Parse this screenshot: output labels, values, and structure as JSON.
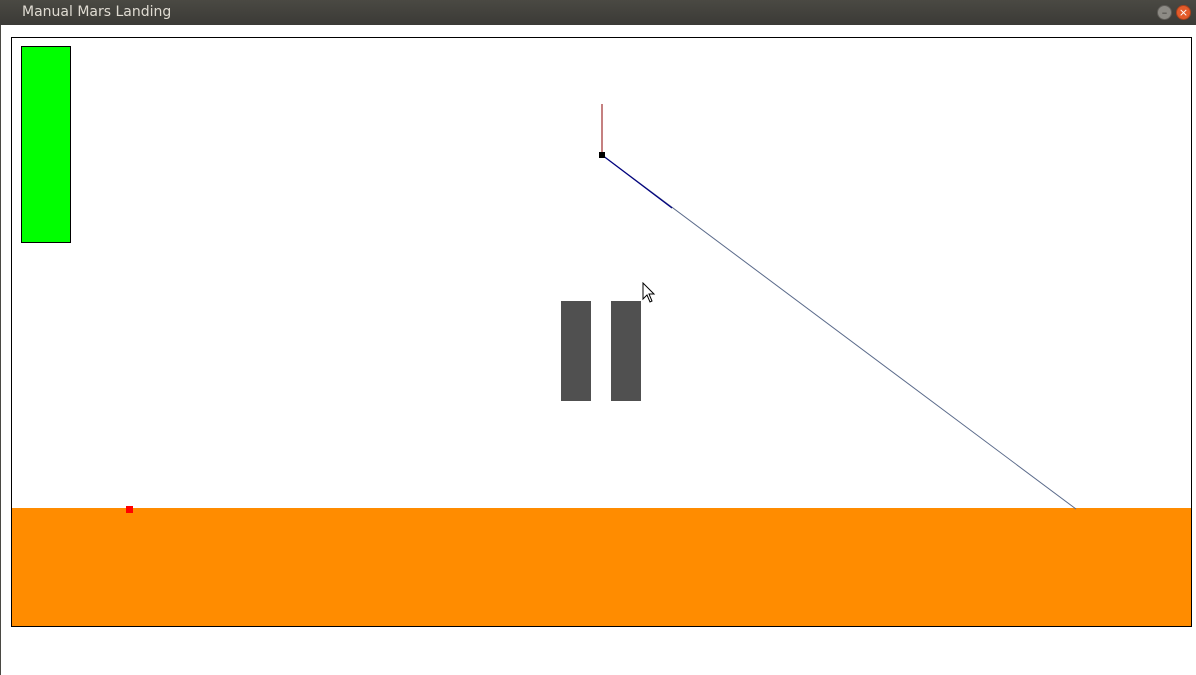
{
  "window": {
    "title": "Manual Mars Landing",
    "minimize_glyph": "–",
    "close_glyph": "×"
  },
  "game": {
    "colors": {
      "ground": "#ff8c00",
      "fuel_gauge": "#00ff00",
      "landing_pad": "#ff0000",
      "thrust_vector": "#8b0000",
      "trajectory": "#000080",
      "pause_icon": "#505050"
    },
    "fuel_level": 1.0,
    "paused": true,
    "icons": [
      "lander-icon",
      "pause-icon",
      "mouse-cursor-icon"
    ]
  }
}
